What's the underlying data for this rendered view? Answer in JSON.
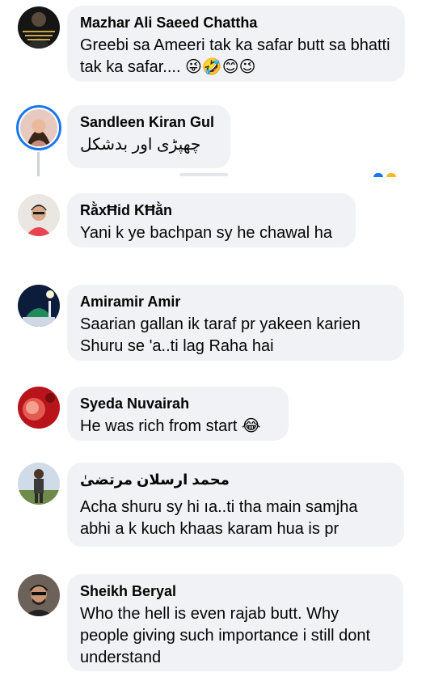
{
  "comments": [
    {
      "author": "Mazhar Ali Saeed Chattha",
      "text": "Greebi sa Ameeri tak ka safar butt sa bhatti tak ka safar.... 😜🤣😊😉"
    },
    {
      "author": "Sandleen Kiran Gul",
      "text": "چھپڑی اور بدشکل"
    },
    {
      "author": "RằxĦid KĦằn",
      "text": "Yani k ye bachpan sy he chawal ha"
    },
    {
      "author": "Amiramir Amir",
      "text": "Saarian gallan ik taraf pr yakeen karien Shuru se 'a..ti lag Raha hai"
    },
    {
      "author": "Syeda Nuvairah",
      "text": "He was rich from start 😂"
    },
    {
      "author": "محمد ارسلان مرتضیٰ",
      "text": "Acha shuru sy hi ıa..ti tha main samjha abhi a k kuch khaas karam hua is pr"
    },
    {
      "author": "Sheikh Beryal",
      "text": "Who the hell is even rajab butt. Why people giving such importance i still dont understand"
    }
  ],
  "colors": {
    "bubble": "#f0f2f5",
    "story_ring": "#1877f2",
    "text": "#050505"
  },
  "icons": {
    "reaction_peek": [
      "like-reaction-icon",
      "haha-reaction-icon"
    ]
  }
}
